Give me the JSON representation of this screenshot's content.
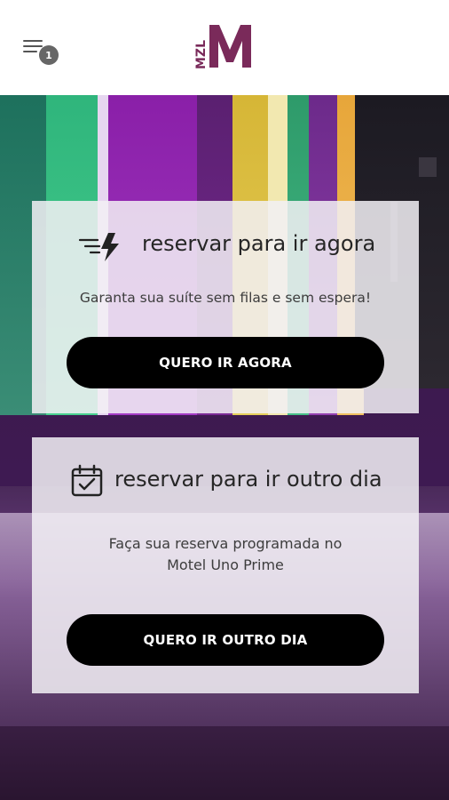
{
  "header": {
    "menu_badge": "1",
    "logo_text_small": "MZL",
    "logo_text_large": "M"
  },
  "cards": {
    "now": {
      "title": "reservar para ir agora",
      "subtitle": "Garanta sua suíte sem filas e sem espera!",
      "button": "QUERO IR AGORA",
      "icon": "fast-lightning-icon"
    },
    "later": {
      "title": "reservar para ir outro dia",
      "subtitle_line1": "Faça sua reserva programada no",
      "subtitle_line2": "Motel Uno Prime",
      "button": "QUERO IR OUTRO DIA",
      "icon": "calendar-check-icon"
    }
  },
  "colors": {
    "logo": "#7a2a5a",
    "button_bg": "#000000",
    "button_text": "#ffffff"
  }
}
